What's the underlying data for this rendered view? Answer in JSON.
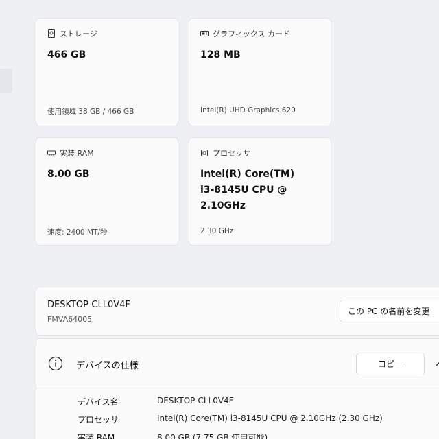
{
  "cards": {
    "storage": {
      "title": "ストレージ",
      "value": "466 GB",
      "sub": "使用領域 38 GB / 466 GB",
      "icon": "storage-icon"
    },
    "gpu": {
      "title": "グラフィックス カード",
      "value": "128 MB",
      "sub": "Intel(R) UHD Graphics 620",
      "icon": "graphics-card-icon"
    },
    "ram": {
      "title": "実装 RAM",
      "value": "8.00 GB",
      "sub": "速度: 2400 MT/秒",
      "icon": "memory-icon"
    },
    "cpu": {
      "title": "プロセッサ",
      "value_lines": [
        "Intel(R) Core(TM)",
        "i3-8145U CPU @",
        "2.10GHz"
      ],
      "sub": "2.30 GHz",
      "icon": "processor-icon"
    }
  },
  "device": {
    "name": "DESKTOP-CLL0V4F",
    "model": "FMVA64005",
    "rename_button": "この PC の名前を変更"
  },
  "specs": {
    "title": "デバイスの仕様",
    "copy_button": "コピー",
    "rows": [
      {
        "key": "デバイス名",
        "value": "DESKTOP-CLL0V4F"
      },
      {
        "key": "プロセッサ",
        "value": "Intel(R) Core(TM) i3-8145U CPU @ 2.10GHz (2.30 GHz)"
      },
      {
        "key": "実装 RAM",
        "value": "8.00 GB (7.75 GB 使用可能)"
      }
    ]
  },
  "colors": {
    "background": "#eef0f4",
    "card": "#fbfbfc",
    "border": "#e3e5e8"
  }
}
